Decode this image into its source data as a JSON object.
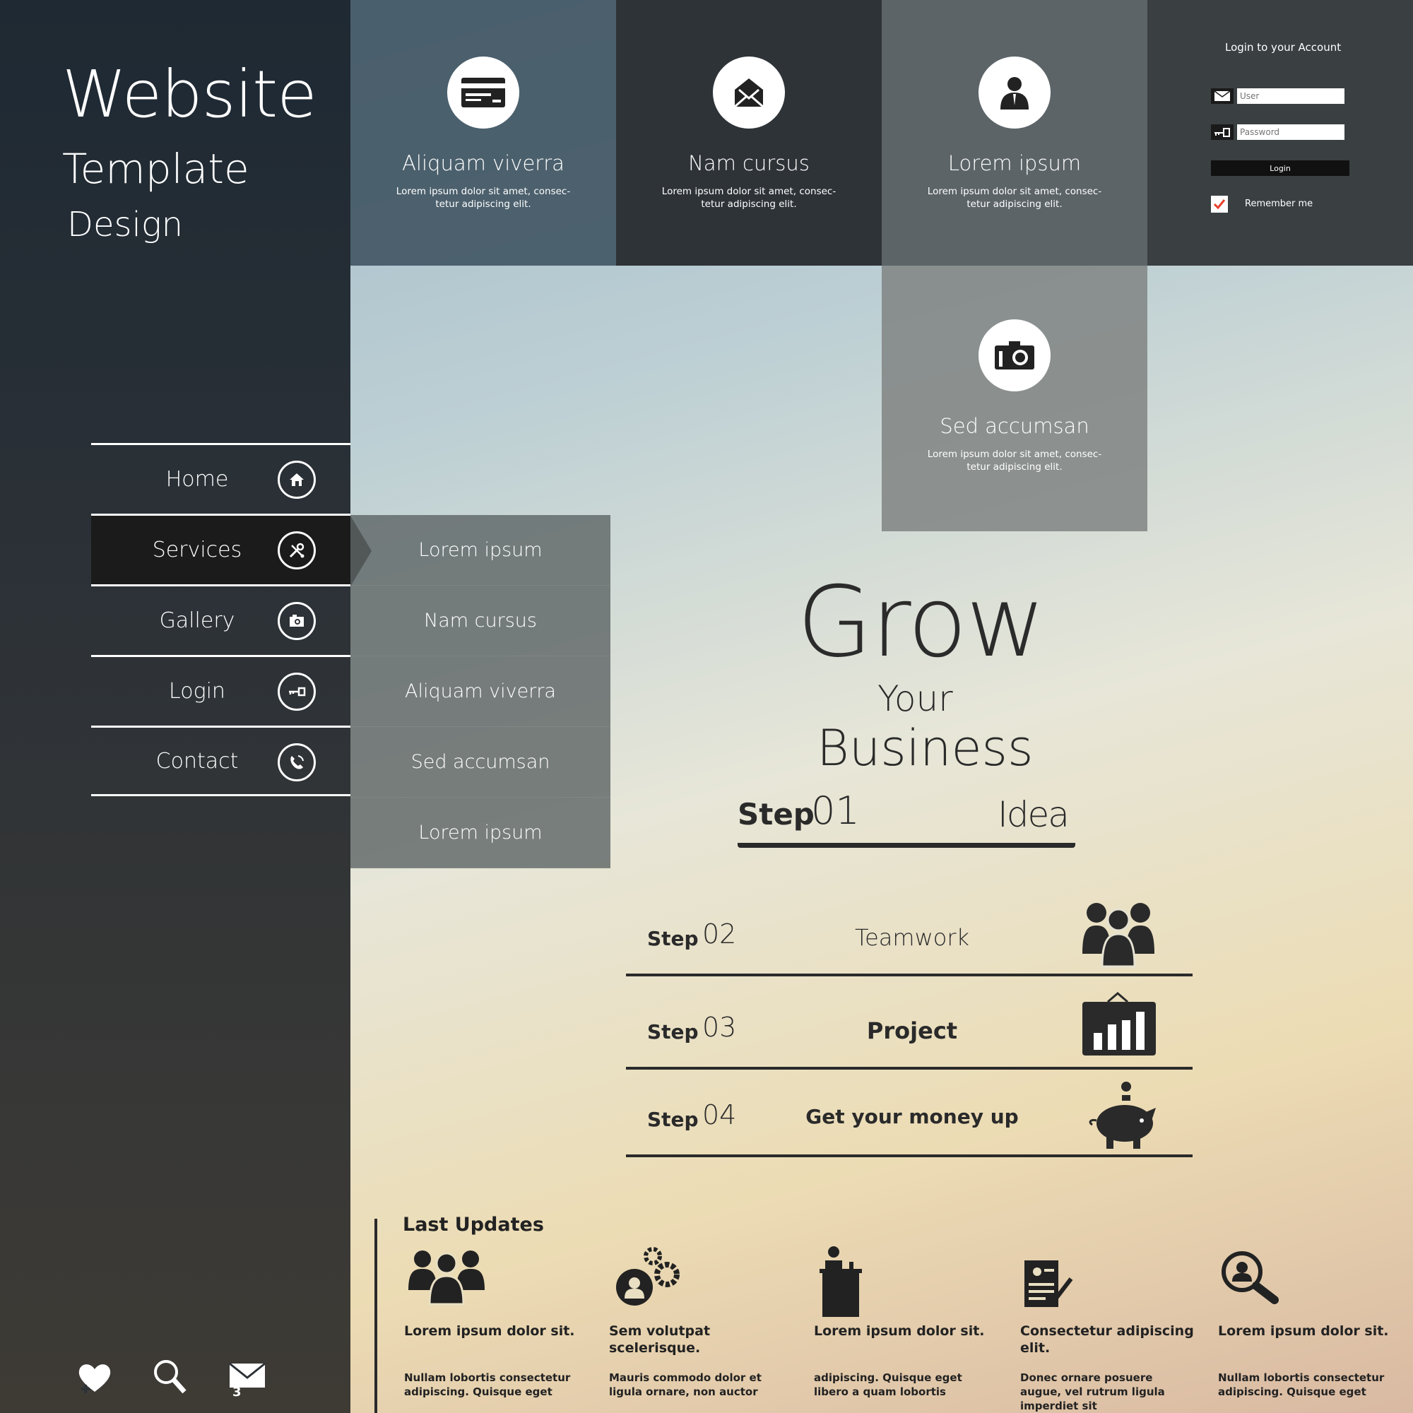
{
  "brand": {
    "line1": "Website",
    "line2": "Template",
    "line3": "Design"
  },
  "nav": [
    {
      "label": "Home",
      "icon": "home-icon"
    },
    {
      "label": "Services",
      "icon": "tools-icon",
      "active": true
    },
    {
      "label": "Gallery",
      "icon": "camera-icon"
    },
    {
      "label": "Login",
      "icon": "key-icon"
    },
    {
      "label": "Contact",
      "icon": "phone-icon"
    }
  ],
  "submenu": [
    "Lorem ipsum",
    "Nam cursus",
    "Aliquam viverra",
    "Sed accumsan",
    "Lorem ipsum"
  ],
  "tiles": [
    {
      "title": "Aliquam viverra",
      "desc": "Lorem ipsum dolor sit amet, consec-tetur adipiscing elit.",
      "icon": "credit-card-icon"
    },
    {
      "title": "Nam cursus",
      "desc": "Lorem ipsum dolor sit amet, consec-tetur adipiscing elit.",
      "icon": "envelope-open-icon"
    },
    {
      "title": "Lorem ipsum",
      "desc": "Lorem ipsum dolor sit amet, consec-tetur adipiscing elit.",
      "icon": "user-icon"
    },
    {
      "title": "Sed accumsan",
      "desc": "Lorem ipsum dolor sit amet, consec-tetur adipiscing elit.",
      "icon": "camera-icon"
    }
  ],
  "login": {
    "title": "Login to your Account",
    "user_placeholder": "User",
    "password_placeholder": "Password",
    "button": "Login",
    "remember": "Remember me",
    "checkbox_color": "#e8412c"
  },
  "grow": {
    "line1": "Grow",
    "line2": "Your",
    "line3": "Business"
  },
  "steps": [
    {
      "word": "Step",
      "num": "01",
      "name": "Idea"
    },
    {
      "word": "Step",
      "num": "02",
      "name": "Teamwork",
      "icon": "team-icon"
    },
    {
      "word": "Step",
      "num": "03",
      "name": "Project",
      "icon": "chart-board-icon"
    },
    {
      "word": "Step",
      "num": "04",
      "name": "Get your money up",
      "icon": "piggy-bank-icon"
    }
  ],
  "updates": {
    "title": "Last Updates",
    "items": [
      {
        "head": "Lorem ipsum dolor sit.",
        "text": "Nullam lobortis consectetur adipiscing. Quisque eget",
        "icon": "group-icon"
      },
      {
        "head": "Sem volutpat scelerisque.",
        "text": "Mauris commodo dolor et ligula ornare, non auctor",
        "icon": "gears-user-icon"
      },
      {
        "head": "Lorem ipsum dolor sit.",
        "text": "adipiscing. Quisque eget libero a quam lobortis",
        "icon": "speaker-podium-icon"
      },
      {
        "head": "Consectetur adipiscing elit.",
        "text": "Donec ornare posuere augue, vel rutrum ligula imperdiet sit",
        "icon": "resume-icon"
      },
      {
        "head": "Lorem ipsum dolor sit.",
        "text": "Nullam lobortis consectetur adipiscing. Quisque eget",
        "icon": "user-search-icon"
      }
    ]
  },
  "bottom_icons": [
    "heart-add-icon",
    "search-icon",
    "mail-icon"
  ],
  "mail_badge": "3"
}
